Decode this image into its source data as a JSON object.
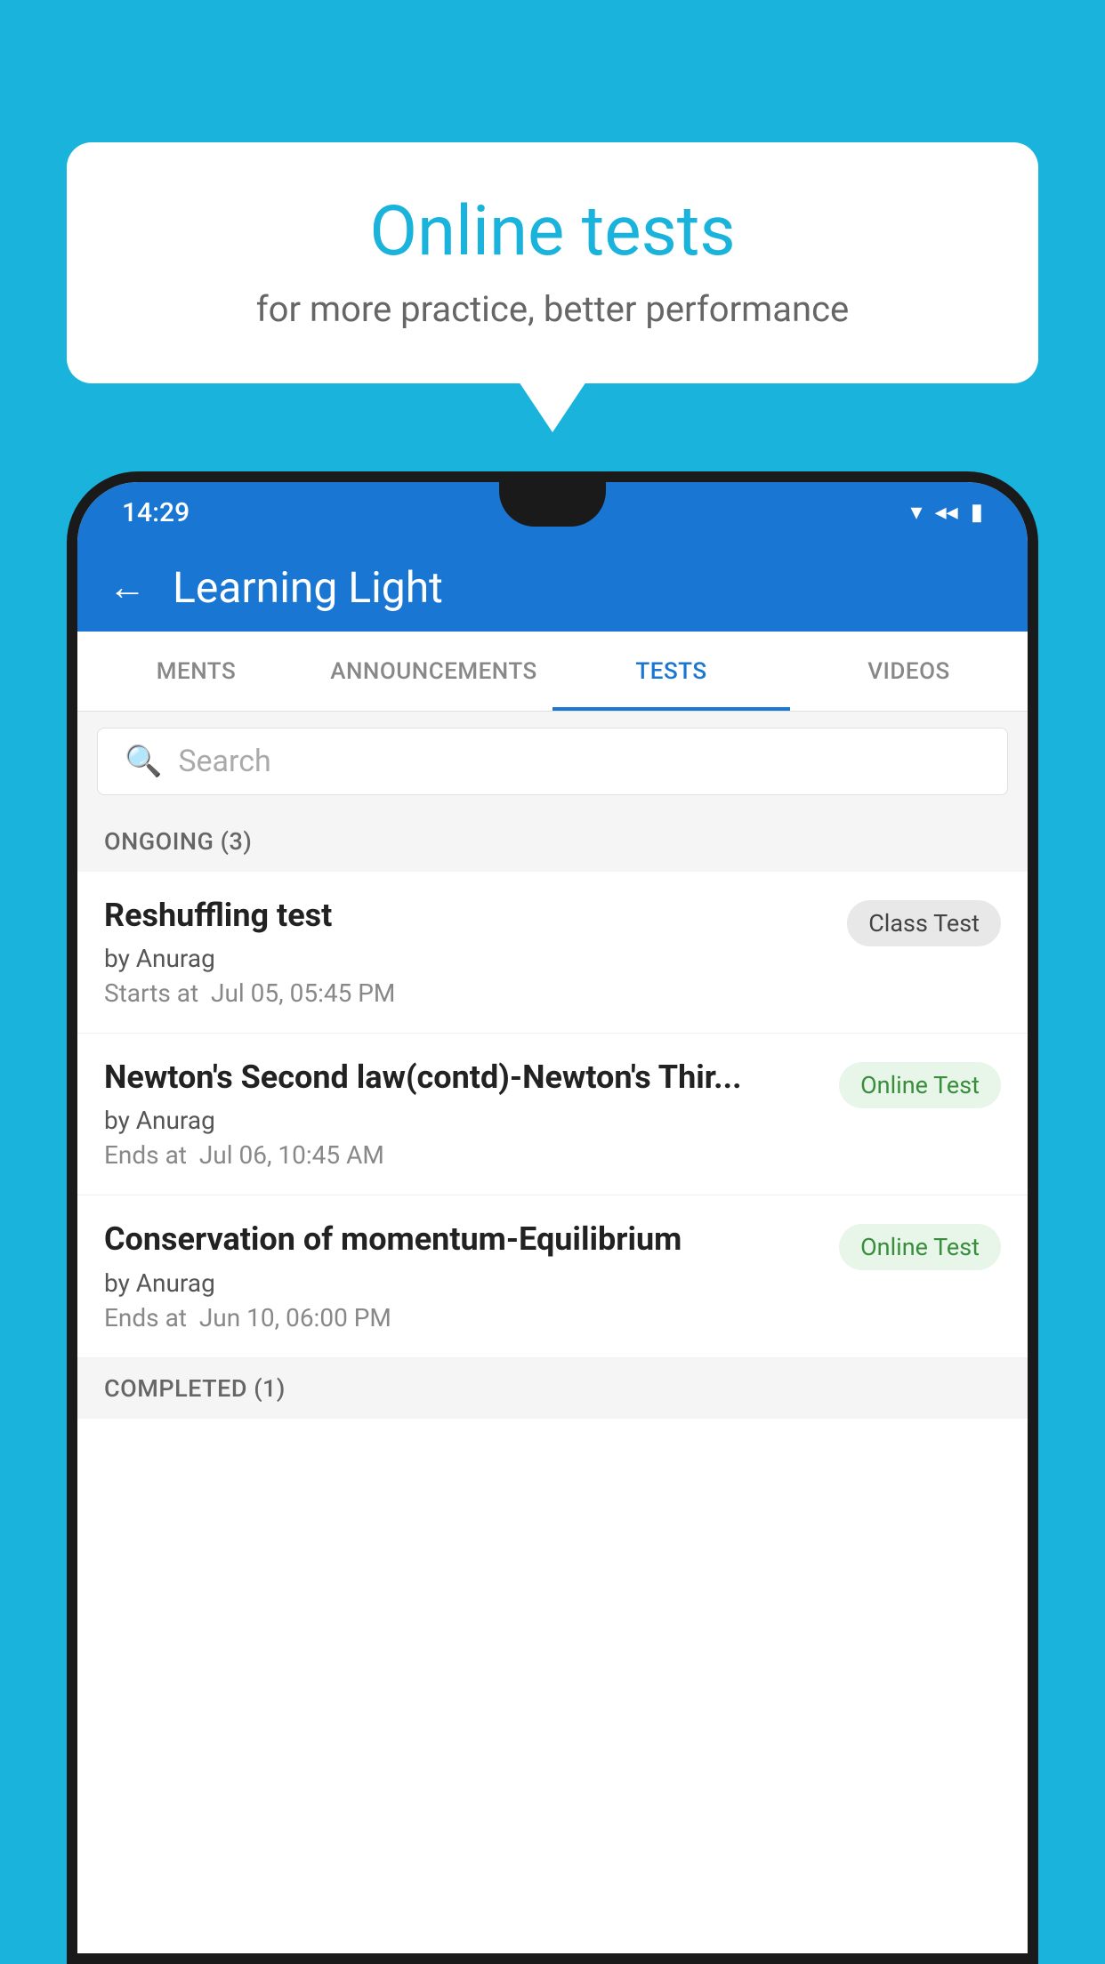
{
  "background": {
    "color": "#1ab3dc"
  },
  "speech_bubble": {
    "title": "Online tests",
    "subtitle": "for more practice, better performance"
  },
  "status_bar": {
    "time": "14:29",
    "wifi": "▼",
    "signal": "◀",
    "battery": "▮"
  },
  "app_bar": {
    "title": "Learning Light",
    "back_label": "←"
  },
  "tabs": [
    {
      "label": "MENTS",
      "active": false
    },
    {
      "label": "ANNOUNCEMENTS",
      "active": false
    },
    {
      "label": "TESTS",
      "active": true
    },
    {
      "label": "VIDEOS",
      "active": false
    }
  ],
  "search": {
    "placeholder": "Search"
  },
  "sections": [
    {
      "header": "ONGOING (3)",
      "tests": [
        {
          "name": "Reshuffling test",
          "author": "by Anurag",
          "time_label": "Starts at",
          "time_value": "Jul 05, 05:45 PM",
          "badge": "Class Test",
          "badge_type": "class"
        },
        {
          "name": "Newton's Second law(contd)-Newton's Thir...",
          "author": "by Anurag",
          "time_label": "Ends at",
          "time_value": "Jul 06, 10:45 AM",
          "badge": "Online Test",
          "badge_type": "online"
        },
        {
          "name": "Conservation of momentum-Equilibrium",
          "author": "by Anurag",
          "time_label": "Ends at",
          "time_value": "Jun 10, 06:00 PM",
          "badge": "Online Test",
          "badge_type": "online"
        }
      ]
    }
  ],
  "completed_section": {
    "header": "COMPLETED (1)"
  }
}
